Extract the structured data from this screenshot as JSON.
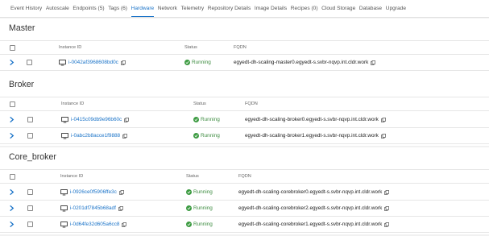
{
  "tabs": [
    {
      "label": "Event History",
      "active": false
    },
    {
      "label": "Autoscale",
      "active": false
    },
    {
      "label": "Endpoints (5)",
      "active": false
    },
    {
      "label": "Tags (6)",
      "active": false
    },
    {
      "label": "Hardware",
      "active": true
    },
    {
      "label": "Network",
      "active": false
    },
    {
      "label": "Telemetry",
      "active": false
    },
    {
      "label": "Repository Details",
      "active": false
    },
    {
      "label": "Image Details",
      "active": false
    },
    {
      "label": "Recipes (0)",
      "active": false
    },
    {
      "label": "Cloud Storage",
      "active": false
    },
    {
      "label": "Database",
      "active": false
    },
    {
      "label": "Upgrade",
      "active": false
    }
  ],
  "columns": {
    "instance_id": "Instance ID",
    "status": "Status",
    "fqdn": "FQDN"
  },
  "colors": {
    "accent": "#1a73c8",
    "running": "#3d8c40"
  },
  "groups": [
    {
      "title": "Master",
      "rows": [
        {
          "instance_id": "i-0042af3968608bd0c",
          "status": "Running",
          "fqdn": "egyedt-dh-scaling-master0.egyedt-s.svbr-nqvp.int.cldr.work"
        }
      ]
    },
    {
      "title": "Broker",
      "rows": [
        {
          "instance_id": "i-0415c09db9e96b60c",
          "status": "Running",
          "fqdn": "egyedt-dh-scaling-broker0.egyedt-s.svbr-nqvp.int.cldr.work"
        },
        {
          "instance_id": "i-0abc2b8acce1f9888",
          "status": "Running",
          "fqdn": "egyedt-dh-scaling-broker1.egyedt-s.svbr-nqvp.int.cldr.work"
        }
      ]
    },
    {
      "title": "Core_broker",
      "rows": [
        {
          "instance_id": "i-0926ce0f5906ffe3c",
          "status": "Running",
          "fqdn": "egyedt-dh-scaling-corebroker0.egyedt-s.svbr-nqvp.int.cldr.work"
        },
        {
          "instance_id": "i-0201df7845b68adf",
          "status": "Running",
          "fqdn": "egyedt-dh-scaling-corebroker2.egyedt-s.svbr-nqvp.int.cldr.work"
        },
        {
          "instance_id": "i-0d64fe32d605a6cc8",
          "status": "Running",
          "fqdn": "egyedt-dh-scaling-corebroker1.egyedt-s.svbr-nqvp.int.cldr.work"
        }
      ]
    }
  ]
}
